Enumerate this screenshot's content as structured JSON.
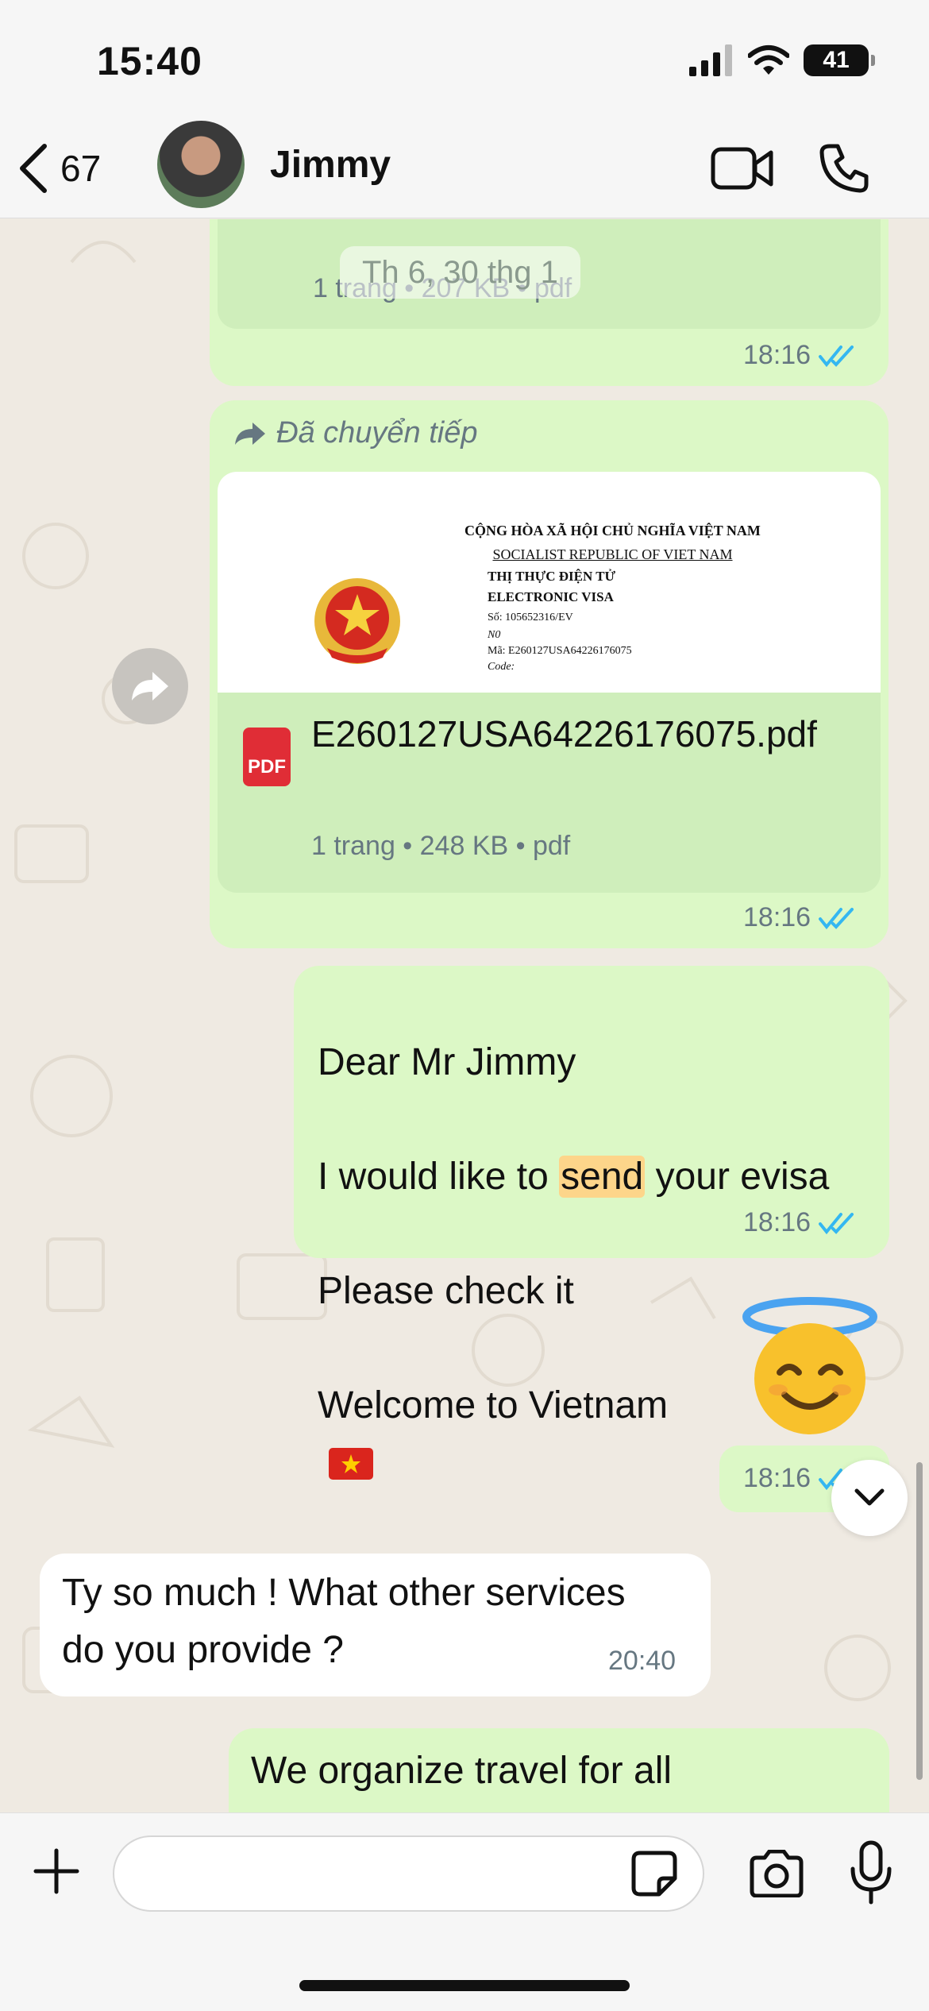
{
  "status_bar": {
    "time": "15:40",
    "battery": "41"
  },
  "header": {
    "back_count": "67",
    "contact_name": "Jimmy"
  },
  "chat": {
    "date_separator": "Th 6, 30 thg 1",
    "messages": [
      {
        "doc_info": "1 trang • 207 KB • pdf",
        "time": "18:16"
      },
      {
        "forwarded_label": "Đã chuyển tiếp",
        "preview": {
          "line1": "CỘNG HÒA XÃ HỘI CHỦ NGHĨA VIỆT NAM",
          "line2": "SOCIALIST REPUBLIC OF VIET NAM",
          "line3": "THỊ THỰC ĐIỆN TỬ",
          "line4": "ELECTRONIC VISA",
          "line5": "Số: 105652316/EV",
          "line6": "N0",
          "line7": "Mã: E260127USA64226176075",
          "line8": "Code:"
        },
        "pdf_badge": "PDF",
        "doc_name": "E260127USA64226176075.pdf",
        "doc_info": "1 trang • 248 KB • pdf",
        "time": "18:16"
      },
      {
        "line1": "Dear  Mr Jimmy",
        "line2_pre": "I would like to ",
        "line2_highlight": "send",
        "line2_post": " your evisa",
        "line3": "Please check it",
        "line4": "Welcome to Vietnam",
        "time": "18:16"
      },
      {
        "emoji": "😇",
        "time": "18:16"
      },
      {
        "text": "Ty so much !  What other services\ndo you provide ?",
        "time": "20:40"
      },
      {
        "text": "We organize travel for all"
      }
    ]
  },
  "input": {
    "placeholder": ""
  },
  "colors": {
    "outgoing_bubble": "#dcf8c6",
    "incoming_bubble": "#ffffff",
    "read_ticks": "#34b7f1",
    "pdf_red": "#e02d36",
    "highlight": "#fdd58a"
  },
  "icons": {
    "back": "chevron-left-icon",
    "video": "video-camera-icon",
    "call": "phone-icon",
    "forward": "forward-arrow-icon",
    "scroll_down": "chevron-down-icon",
    "attach": "plus-icon",
    "sticker": "sticker-icon",
    "camera": "camera-icon",
    "mic": "microphone-icon"
  }
}
